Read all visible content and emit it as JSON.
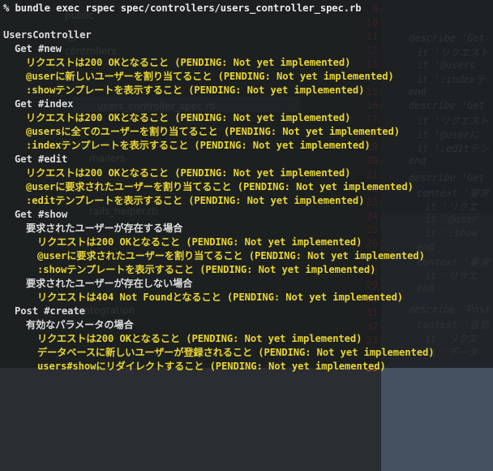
{
  "ide_background": {
    "tree_items": [
      "public",
      "ler",
      "controllers",
      "users_controller_spec.rb",
      "ers",
      "mailers",
      "rails_helper.rb",
      "integration"
    ],
    "line_numbers": [
      "9",
      "10",
      "11",
      "12",
      "13",
      "14",
      "15",
      "16",
      "17",
      "18",
      "19",
      "20",
      "21",
      "22",
      "23",
      "24",
      "25",
      "26",
      "27",
      "28",
      "29",
      "30",
      "31",
      "32",
      "33",
      "34",
      "35"
    ],
    "code_fragments": [
      "describe 'Get",
      "it 'リクエスト",
      "it '@users",
      "it ':indexテ",
      "end",
      "describe 'Get",
      "it 'リクエスト",
      "it '@userに",
      "it ':editテン",
      "end",
      "describe 'Get",
      "context '要求",
      "it 'リクエ",
      "it '@user",
      "it ':show",
      "end",
      "context '要求",
      "it 'リクエ",
      "end",
      "describe 'Post",
      "context '有効",
      "it 'リクエ",
      "it 'データ"
    ]
  },
  "terminal": {
    "lines": [
      {
        "kind": "cmd",
        "indent": 0,
        "text": "% bundle exec rspec spec/controllers/users_controller_spec.rb"
      },
      {
        "kind": "blank",
        "indent": 0,
        "text": ""
      },
      {
        "kind": "hdr",
        "indent": 0,
        "text": "UsersController"
      },
      {
        "kind": "ctx",
        "indent": 1,
        "text": "Get #new"
      },
      {
        "kind": "pend",
        "indent": 2,
        "text": "リクエストは200 OKとなること (PENDING: Not yet implemented)"
      },
      {
        "kind": "pend",
        "indent": 2,
        "text": "@userに新しいユーザーを割り当てること (PENDING: Not yet implemented)"
      },
      {
        "kind": "pend",
        "indent": 2,
        "text": ":showテンプレートを表示すること (PENDING: Not yet implemented)"
      },
      {
        "kind": "ctx",
        "indent": 1,
        "text": "Get #index"
      },
      {
        "kind": "pend",
        "indent": 2,
        "text": "リクエストは200 OKとなること (PENDING: Not yet implemented)"
      },
      {
        "kind": "pend",
        "indent": 2,
        "text": "@usersに全てのユーザーを割り当てること (PENDING: Not yet implemented)"
      },
      {
        "kind": "pend",
        "indent": 2,
        "text": ":indexテンプレートを表示すること (PENDING: Not yet implemented)"
      },
      {
        "kind": "ctx",
        "indent": 1,
        "text": "Get #edit"
      },
      {
        "kind": "pend",
        "indent": 2,
        "text": "リクエストは200 OKとなること (PENDING: Not yet implemented)"
      },
      {
        "kind": "pend",
        "indent": 2,
        "text": "@userに要求されたユーザーを割り当てること (PENDING: Not yet implemented)"
      },
      {
        "kind": "pend",
        "indent": 2,
        "text": ":editテンプレートを表示すること (PENDING: Not yet implemented)"
      },
      {
        "kind": "ctx",
        "indent": 1,
        "text": "Get #show"
      },
      {
        "kind": "ctx",
        "indent": 2,
        "text": "要求されたユーザーが存在する場合"
      },
      {
        "kind": "pend",
        "indent": 3,
        "text": "リクエストは200 OKとなること (PENDING: Not yet implemented)"
      },
      {
        "kind": "pend",
        "indent": 3,
        "text": "@userに要求されたユーザーを割り当てること (PENDING: Not yet implemented)"
      },
      {
        "kind": "pend",
        "indent": 3,
        "text": ":showテンプレートを表示すること (PENDING: Not yet implemented)"
      },
      {
        "kind": "ctx",
        "indent": 2,
        "text": "要求されたユーザーが存在しない場合"
      },
      {
        "kind": "pend",
        "indent": 3,
        "text": "リクエストは404 Not Foundとなること (PENDING: Not yet implemented)"
      },
      {
        "kind": "ctx",
        "indent": 1,
        "text": "Post #create"
      },
      {
        "kind": "ctx",
        "indent": 2,
        "text": "有効なパラメータの場合"
      },
      {
        "kind": "pend",
        "indent": 3,
        "text": "リクエストは200 OKとなること (PENDING: Not yet implemented)"
      },
      {
        "kind": "pend",
        "indent": 3,
        "text": "データベースに新しいユーザーが登録されること (PENDING: Not yet implemented)"
      },
      {
        "kind": "pend",
        "indent": 3,
        "text": "users#showにリダイレクトすること (PENDING: Not yet implemented)"
      }
    ]
  },
  "colors": {
    "pending": "#e8d534",
    "heading": "#dcdcdc",
    "line_number": "#b44a3a"
  }
}
